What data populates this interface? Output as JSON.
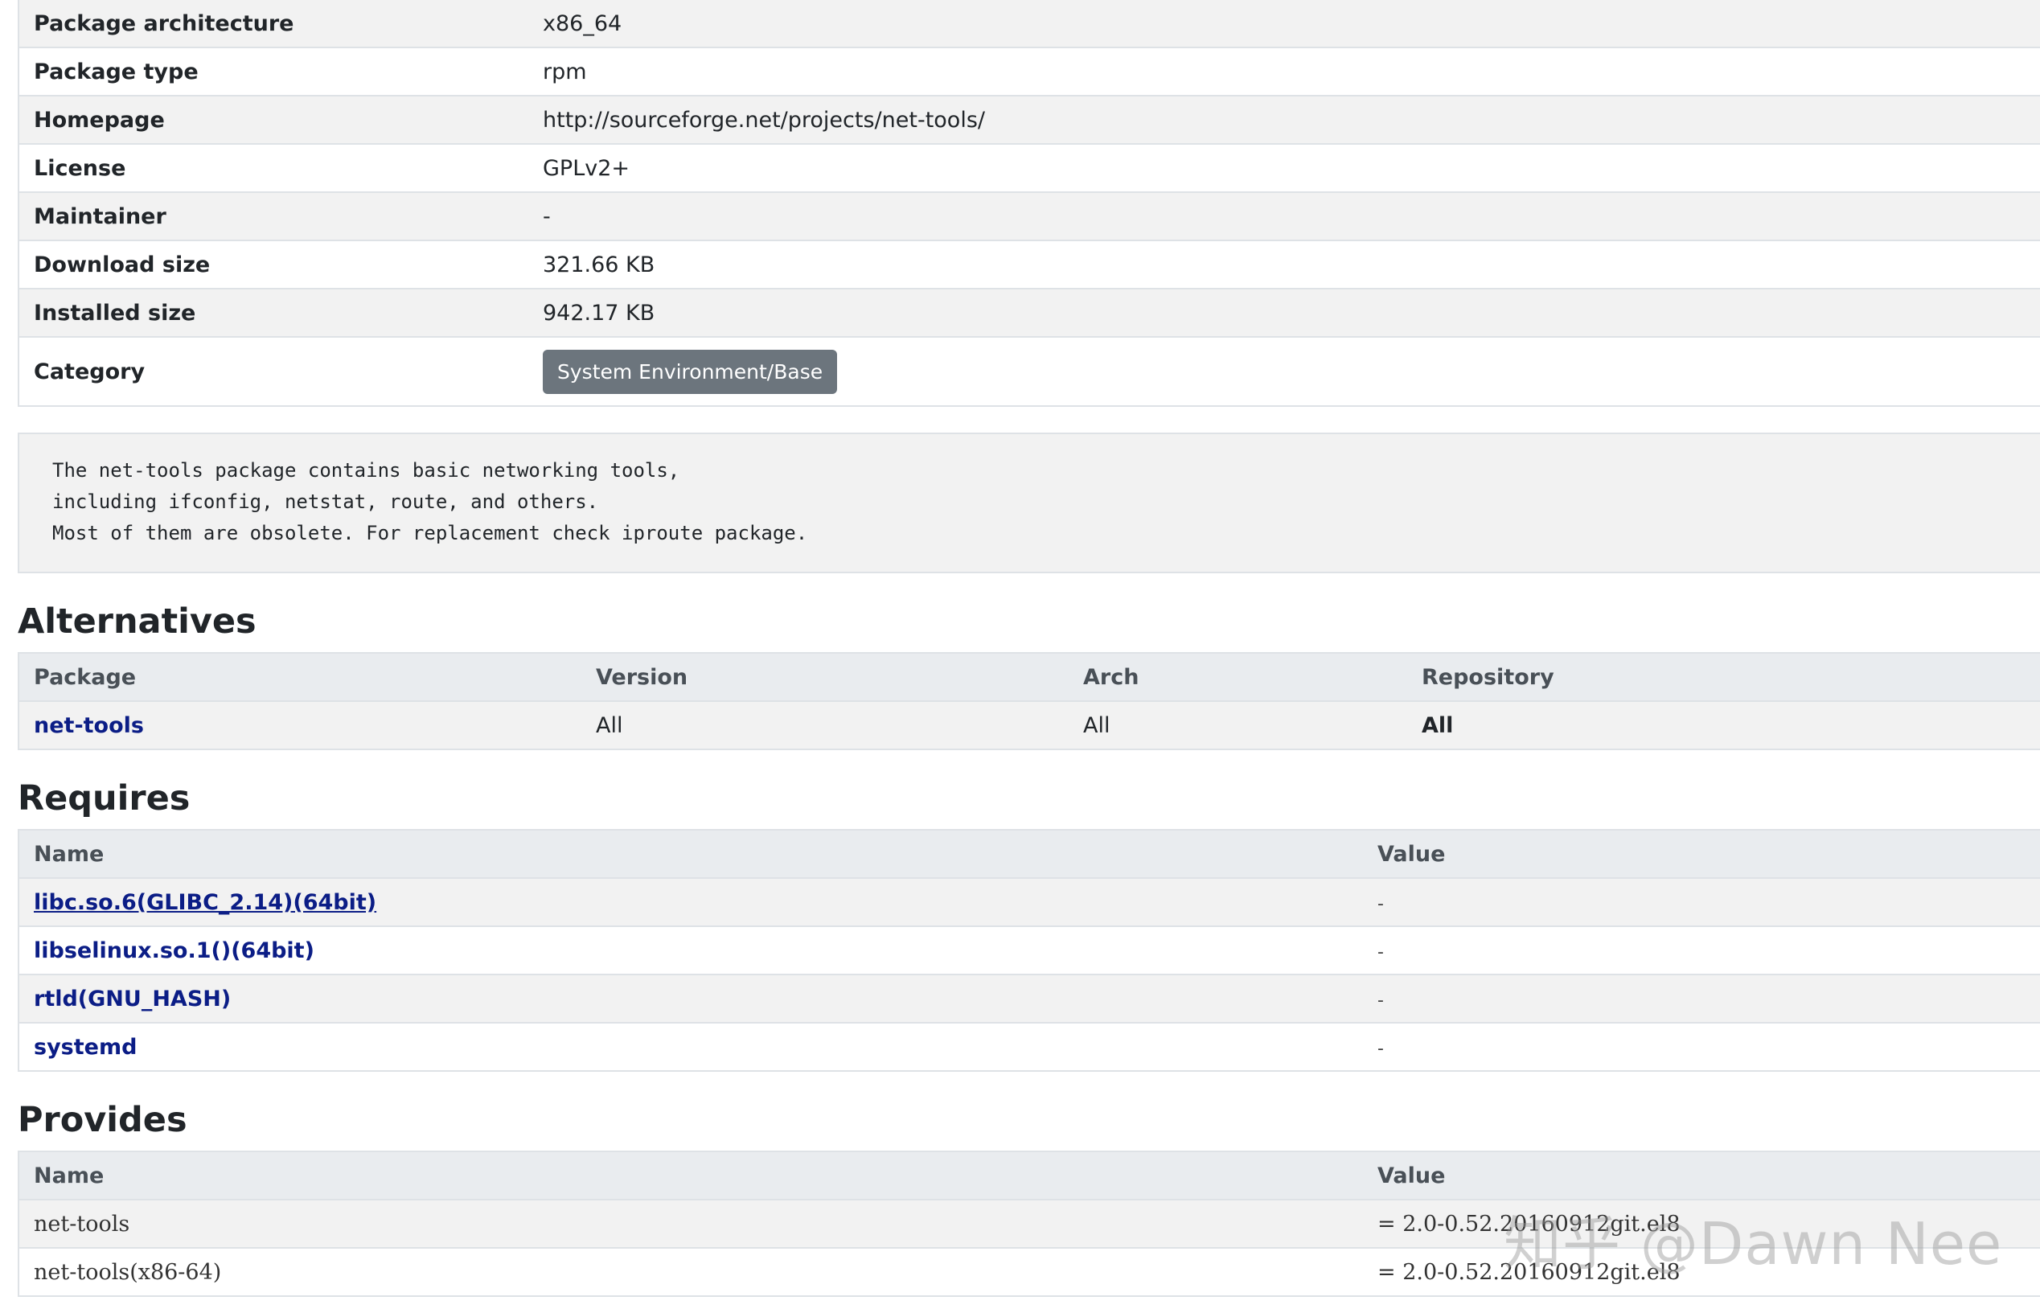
{
  "info": {
    "rows": [
      {
        "key": "Package architecture",
        "value": "x86_64"
      },
      {
        "key": "Package type",
        "value": "rpm"
      },
      {
        "key": "Homepage",
        "value": "http://sourceforge.net/projects/net-tools/"
      },
      {
        "key": "License",
        "value": "GPLv2+"
      },
      {
        "key": "Maintainer",
        "value": "-"
      },
      {
        "key": "Download size",
        "value": "321.66 KB"
      },
      {
        "key": "Installed size",
        "value": "942.17 KB"
      }
    ],
    "category_key": "Category",
    "category_value": "System Environment/Base"
  },
  "description": "The net-tools package contains basic networking tools,\nincluding ifconfig, netstat, route, and others.\nMost of them are obsolete. For replacement check iproute package.",
  "alternatives": {
    "heading": "Alternatives",
    "columns": [
      "Package",
      "Version",
      "Arch",
      "Repository"
    ],
    "rows": [
      {
        "package": "net-tools",
        "version": "All",
        "arch": "All",
        "repository": "All"
      }
    ]
  },
  "requires": {
    "heading": "Requires",
    "columns": [
      "Name",
      "Value"
    ],
    "rows": [
      {
        "name": "libc.so.6(GLIBC_2.14)(64bit)",
        "value": "-"
      },
      {
        "name": "libselinux.so.1()(64bit)",
        "value": "-"
      },
      {
        "name": "rtld(GNU_HASH)",
        "value": "-"
      },
      {
        "name": "systemd",
        "value": "-"
      }
    ]
  },
  "provides": {
    "heading": "Provides",
    "columns": [
      "Name",
      "Value"
    ],
    "rows": [
      {
        "name": "net-tools",
        "value": "= 2.0-0.52.20160912git.el8"
      },
      {
        "name": "net-tools(x86-64)",
        "value": "= 2.0-0.52.20160912git.el8"
      }
    ]
  },
  "watermark": "知乎 @Dawn Nee"
}
